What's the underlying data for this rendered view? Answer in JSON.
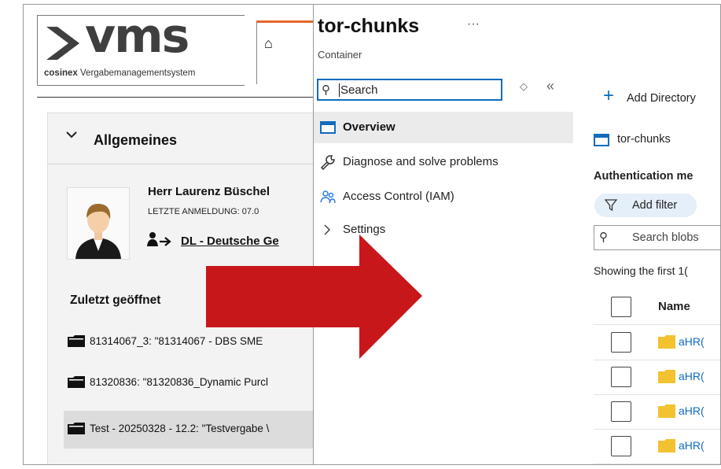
{
  "vms": {
    "logo_text": "vms",
    "logo_sub_bold": "cosinex",
    "logo_sub_rest": " Vergabemanagementsystem",
    "home_icon": "home-icon",
    "section_title": "Allgemeines",
    "user_name": "Herr Laurenz Büschel",
    "last_login": "LETZTE ANMELDUNG: 07.0",
    "organization": "DL - Deutsche Ge",
    "recent_title": "Zuletzt geöffnet",
    "recent_items": [
      {
        "label": "81314067_3: \"81314067 - DBS SME"
      },
      {
        "label": "81320836: \"81320836_Dynamic Purcl"
      },
      {
        "label": "Test - 20250328 - 12.2: \"Testvergabe \\"
      }
    ],
    "accent_color": "#e5662b"
  },
  "azure": {
    "title": "tor-chunks",
    "more": "···",
    "subtitle": "Container",
    "search_placeholder": "Search",
    "sort_icon": "◇",
    "collapse_icon": "«",
    "nav": [
      {
        "label": "Overview",
        "icon": "overview-icon",
        "active": true
      },
      {
        "label": "Diagnose and solve problems",
        "icon": "wrench-icon"
      },
      {
        "label": "Access Control (IAM)",
        "icon": "people-icon"
      },
      {
        "label": "Settings",
        "icon": "chevron-right-icon"
      }
    ],
    "add_directory": "Add Directory",
    "breadcrumb": "tor-chunks",
    "auth_label": "Authentication me",
    "add_filter": "Add filter",
    "search_blobs": "Search blobs",
    "showing": "Showing the first 1(",
    "table_header": "Name",
    "rows": [
      {
        "name": "aHR("
      },
      {
        "name": "aHR("
      },
      {
        "name": "aHR("
      },
      {
        "name": "aHR("
      }
    ],
    "accent_color": "#0f6cbd"
  },
  "arrow_color": "#c8171b"
}
